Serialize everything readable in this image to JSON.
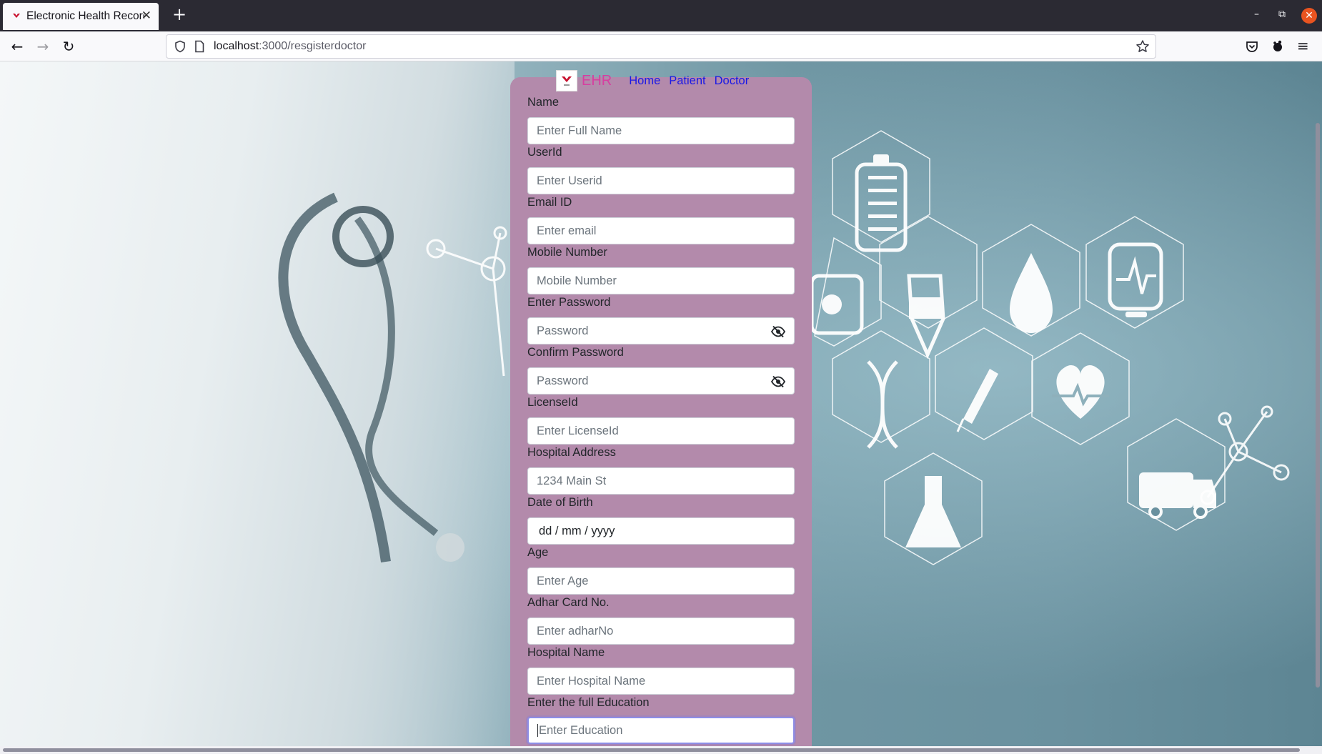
{
  "browser": {
    "tab_title": "Electronic Health Records",
    "url_host": "localhost",
    "url_path": ":3000/resgisterdoctor"
  },
  "header": {
    "brand": "EHR",
    "nav": [
      "Home",
      "Patient",
      "Doctor"
    ]
  },
  "form": {
    "fields": [
      {
        "label": "Name",
        "placeholder": "Enter Full Name"
      },
      {
        "label": "UserId",
        "placeholder": "Enter Userid"
      },
      {
        "label": "Email ID",
        "placeholder": "Enter email"
      },
      {
        "label": "Mobile Number",
        "placeholder": "Mobile Number"
      },
      {
        "label": "Enter Password",
        "placeholder": "Password"
      },
      {
        "label": "Confirm Password",
        "placeholder": "Password"
      },
      {
        "label": "LicenseId",
        "placeholder": "Enter LicenseId"
      },
      {
        "label": "Hospital Address",
        "placeholder": "1234 Main St"
      },
      {
        "label": "Date of Birth",
        "placeholder": "dd / mm / yyyy"
      },
      {
        "label": "Age",
        "placeholder": "Enter Age"
      },
      {
        "label": "Adhar Card No.",
        "placeholder": "Enter adharNo"
      },
      {
        "label": "Hospital Name",
        "placeholder": "Enter Hospital Name"
      },
      {
        "label": "Enter the full Education",
        "placeholder": "Enter Education"
      }
    ]
  },
  "colors": {
    "card": "#b38aab",
    "brand": "#d63fa0",
    "link": "#1a18e6"
  }
}
